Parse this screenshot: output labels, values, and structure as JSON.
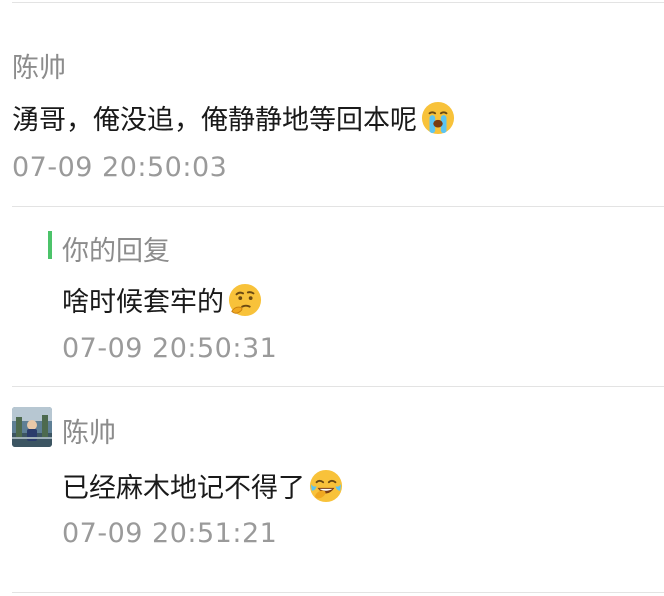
{
  "comments": [
    {
      "author": "陈帅",
      "text": "湧哥，俺没追，俺静静地等回本呢",
      "emoji": "crying-face-icon",
      "time": "07-09 20:50:03"
    },
    {
      "reply_label": "你的回复",
      "text": "啥时候套牢的",
      "emoji": "thinking-face-icon",
      "time": "07-09 20:50:31"
    },
    {
      "author": "陈帅",
      "avatar": "user-avatar",
      "text": "已经麻木地记不得了",
      "emoji": "tears-of-joy-face-icon",
      "time": "07-09 20:51:21"
    }
  ],
  "colors": {
    "reply_accent": "#4cc36a",
    "divider": "#e3e3e3",
    "muted_text": "#9a9a9a"
  }
}
